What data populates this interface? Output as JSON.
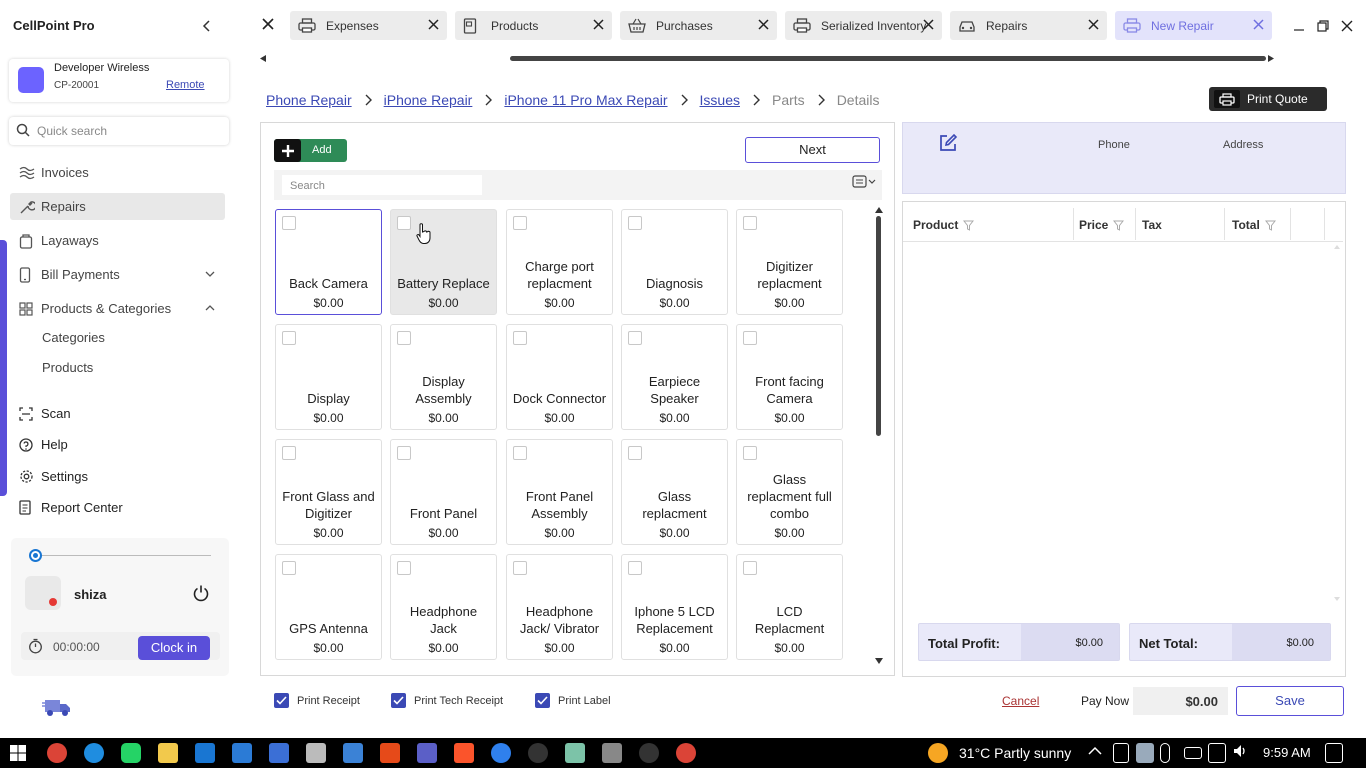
{
  "app": {
    "title": "CellPoint Pro"
  },
  "account": {
    "name": "Developer Wireless",
    "id": "CP-20001",
    "mode": "Remote"
  },
  "quick_search": {
    "placeholder": "Quick search"
  },
  "nav": {
    "invoices": "Invoices",
    "repairs": "Repairs",
    "layaways": "Layaways",
    "bill_payments": "Bill Payments",
    "products_categories": "Products & Categories",
    "categories": "Categories",
    "products": "Products",
    "scan": "Scan",
    "help": "Help",
    "settings": "Settings",
    "report_center": "Report Center"
  },
  "user": {
    "name": "shiza",
    "timer": "00:00:00",
    "clock_in": "Clock in"
  },
  "tabs": [
    "Expenses",
    "Products",
    "Purchases",
    "Serialized Inventory",
    "Repairs",
    "New Repair"
  ],
  "breadcrumb": {
    "phone_repair": "Phone Repair",
    "iphone_repair": "iPhone Repair",
    "model_repair": "iPhone 11 Pro Max Repair",
    "issues": "Issues",
    "parts": "Parts",
    "details": "Details"
  },
  "print_quote": "Print Quote",
  "toolbar": {
    "add": "Add",
    "next": "Next",
    "search_placeholder": "Search"
  },
  "issues": [
    {
      "name": "Back Camera",
      "price": "$0.00"
    },
    {
      "name": "Battery Replace",
      "price": "$0.00"
    },
    {
      "name": "Charge port replacment",
      "price": "$0.00"
    },
    {
      "name": "Diagnosis",
      "price": "$0.00"
    },
    {
      "name": "Digitizer replacment",
      "price": "$0.00"
    },
    {
      "name": "Display",
      "price": "$0.00"
    },
    {
      "name": "Display Assembly",
      "price": "$0.00"
    },
    {
      "name": "Dock Connector",
      "price": "$0.00"
    },
    {
      "name": "Earpiece Speaker",
      "price": "$0.00"
    },
    {
      "name": "Front facing Camera",
      "price": "$0.00"
    },
    {
      "name": "Front Glass and Digitizer",
      "price": "$0.00"
    },
    {
      "name": "Front Panel",
      "price": "$0.00"
    },
    {
      "name": "Front Panel Assembly",
      "price": "$0.00"
    },
    {
      "name": "Glass replacment",
      "price": "$0.00"
    },
    {
      "name": "Glass replacment full combo",
      "price": "$0.00"
    },
    {
      "name": "GPS Antenna",
      "price": "$0.00"
    },
    {
      "name": "Headphone Jack",
      "price": "$0.00"
    },
    {
      "name": "Headphone Jack/ Vibrator",
      "price": "$0.00"
    },
    {
      "name": "Iphone 5 LCD Replacement",
      "price": "$0.00"
    },
    {
      "name": "LCD Replacment",
      "price": "$0.00"
    }
  ],
  "customer": {
    "phone_label": "Phone",
    "address_label": "Address"
  },
  "table": {
    "columns": [
      "Product",
      "Price",
      "Tax",
      "Total"
    ]
  },
  "totals": {
    "profit_label": "Total Profit:",
    "profit_value": "$0.00",
    "net_label": "Net Total:",
    "net_value": "$0.00"
  },
  "bottom": {
    "print_receipt": "Print Receipt",
    "print_tech_receipt": "Print Tech Receipt",
    "print_label": "Print Label",
    "cancel": "Cancel",
    "pay_now": "Pay Now",
    "pay_amount": "$0.00",
    "save": "Save"
  },
  "taskbar": {
    "weather": "31°C  Partly sunny",
    "time": "9:59 AM"
  },
  "colors": {
    "accent": "#5a4fd9",
    "link": "#3b49b5",
    "add_green": "#2e8b57",
    "panel_tint": "#e9e9f9"
  }
}
